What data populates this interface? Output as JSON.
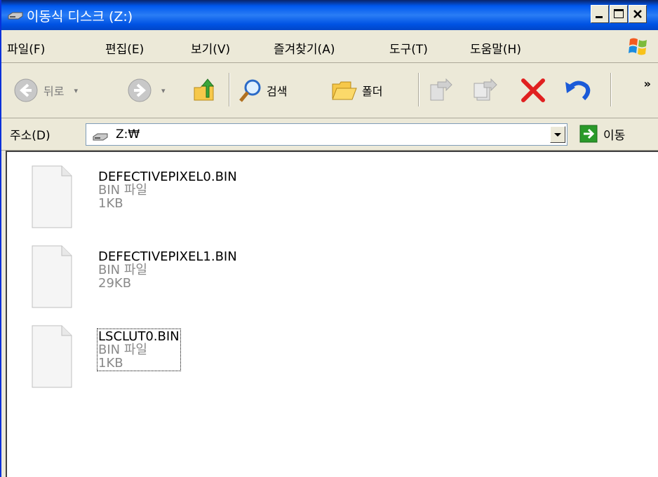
{
  "window": {
    "title": "이동식 디스크 (Z:)"
  },
  "menu": {
    "items": [
      "파일(F)",
      "편집(E)",
      "보기(V)",
      "즐겨찾기(A)",
      "도구(T)",
      "도움말(H)"
    ]
  },
  "toolbar": {
    "back_label": "뒤로",
    "search_label": "검색",
    "folders_label": "폴더",
    "more": "»"
  },
  "address": {
    "label": "주소(D)",
    "value": "Z:₩",
    "go_label": "이동"
  },
  "files": [
    {
      "name": "DEFECTIVEPIXEL0.BIN",
      "type": "BIN 파일",
      "size": "1KB"
    },
    {
      "name": "DEFECTIVEPIXEL1.BIN",
      "type": "BIN 파일",
      "size": "29KB"
    },
    {
      "name": "LSCLUT0.BIN",
      "type": "BIN 파일",
      "size": "1KB",
      "selected": true
    }
  ],
  "colors": {
    "title_bar": "#0058ee",
    "close_red": "#e02020",
    "go_green": "#2a9a2a"
  }
}
